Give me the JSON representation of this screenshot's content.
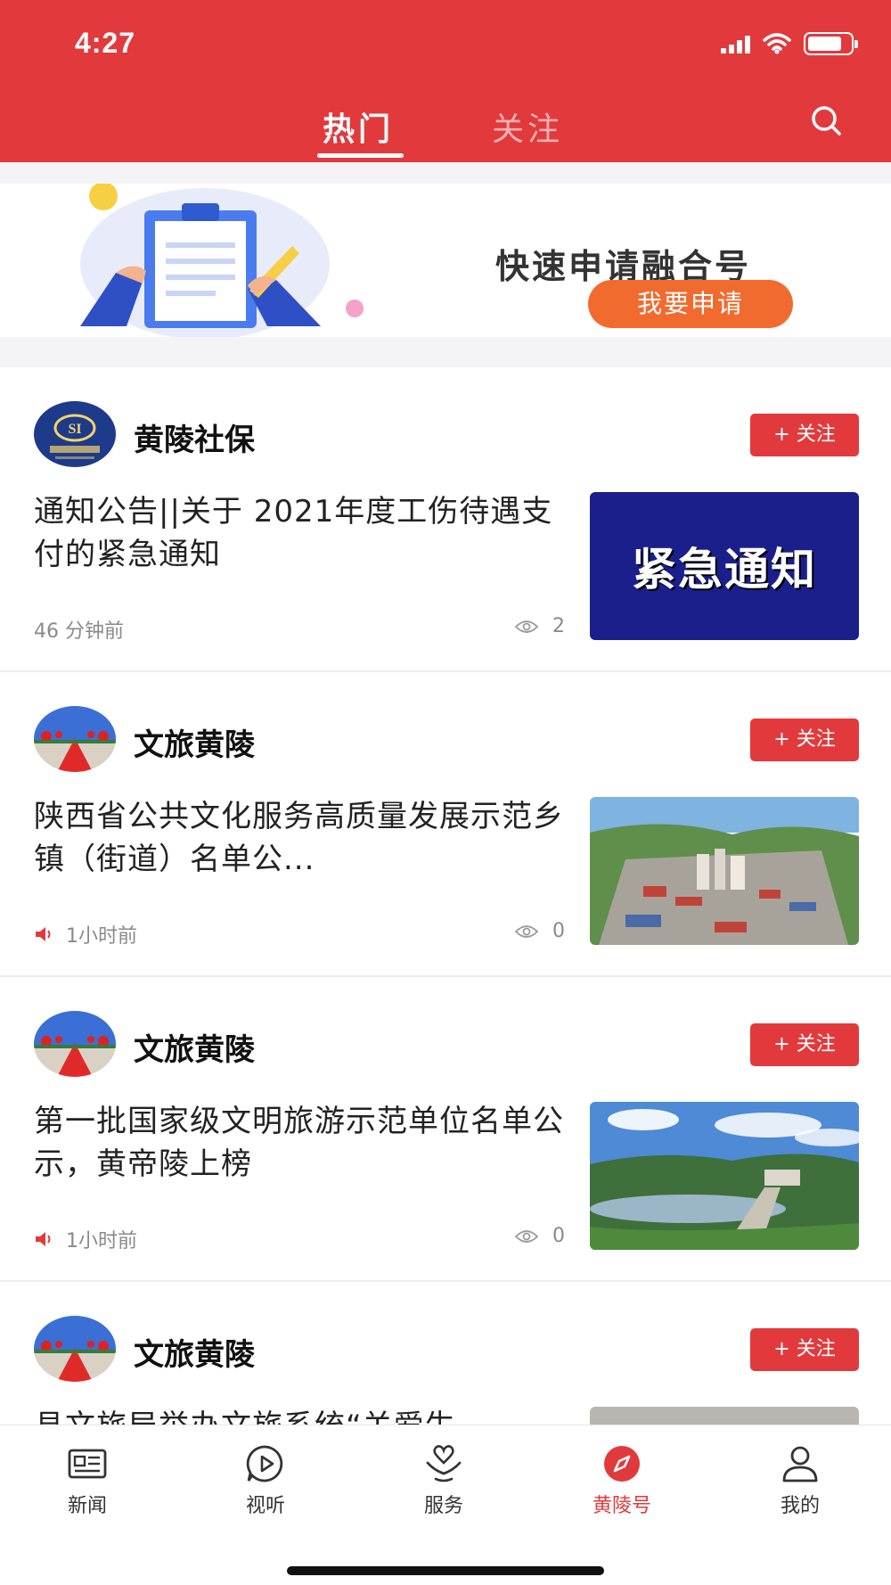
{
  "status_bar": {
    "time": "4:27"
  },
  "header": {
    "tabs": [
      {
        "label": "热门",
        "active": true
      },
      {
        "label": "关注",
        "active": false
      }
    ],
    "search_icon": "search-icon"
  },
  "banner": {
    "title": "快速申请融合号",
    "button_label": "我要申请"
  },
  "feed": [
    {
      "author": "黄陵社保",
      "follow_label": "+ 关注",
      "headline": "通知公告||关于 2021年度工伤待遇支付的紧急通知",
      "time": "46 分钟前",
      "views": "2",
      "audio": false,
      "thumb_text": "紧急通知"
    },
    {
      "author": "文旅黄陵",
      "follow_label": "+ 关注",
      "headline": "陕西省公共文化服务高质量发展示范乡镇（街道）名单公...",
      "time": "1小时前",
      "views": "0",
      "audio": true
    },
    {
      "author": "文旅黄陵",
      "follow_label": "+ 关注",
      "headline": "第一批国家级文明旅游示范单位名单公示，黄帝陵上榜",
      "time": "1小时前",
      "views": "0",
      "audio": true
    },
    {
      "author": "文旅黄陵",
      "follow_label": "+ 关注",
      "headline": "县文旅局举办文旅系统“关爱生",
      "time": "",
      "views": "",
      "audio": false
    }
  ],
  "bottom_nav": [
    {
      "label": "新闻",
      "icon": "newspaper-icon",
      "active": false
    },
    {
      "label": "视听",
      "icon": "play-icon",
      "active": false
    },
    {
      "label": "服务",
      "icon": "heart-hand-icon",
      "active": false
    },
    {
      "label": "黄陵号",
      "icon": "compass-icon",
      "active": true
    },
    {
      "label": "我的",
      "icon": "user-icon",
      "active": false
    }
  ],
  "colors": {
    "brand": "#e23a3c",
    "accent": "#f26b2e"
  }
}
